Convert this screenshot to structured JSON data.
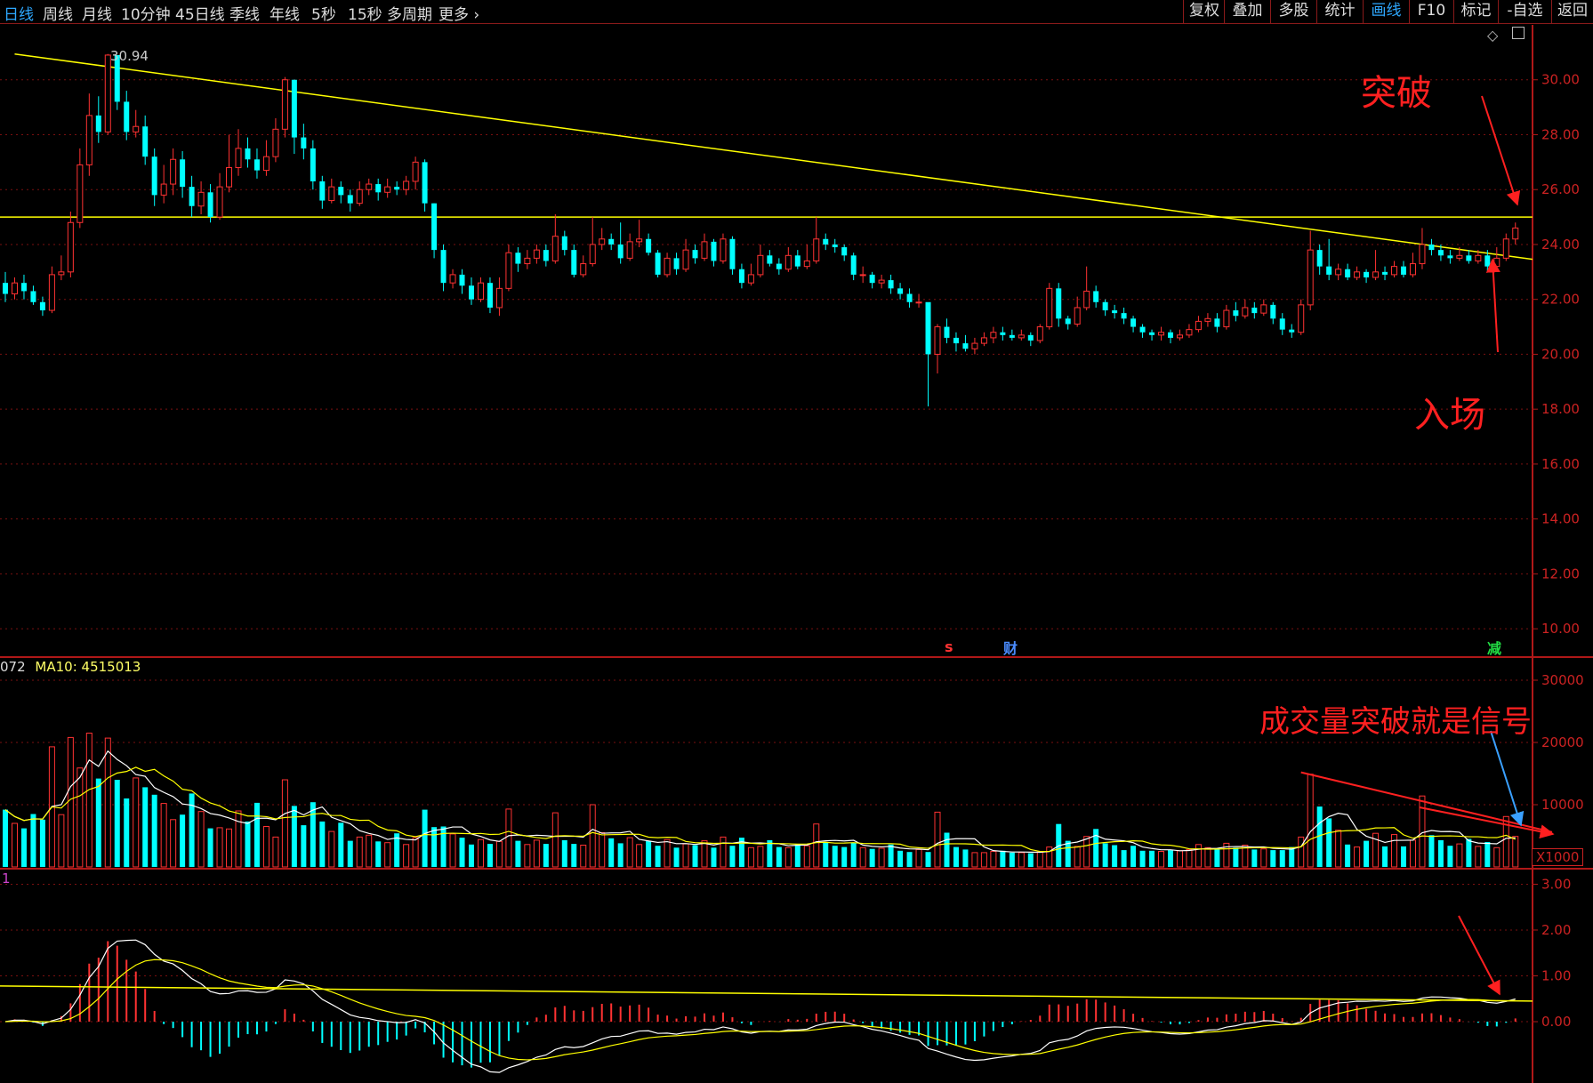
{
  "toolbar": {
    "left_tabs": [
      "日线",
      "周线",
      "月线",
      "10分钟",
      "45日线",
      "季线",
      "年线",
      "5秒",
      "15秒",
      "多周期",
      "更多"
    ],
    "active_left": "日线",
    "right_tabs": [
      "复权",
      "叠加",
      "多股",
      "统计",
      "画线",
      "F10",
      "标记",
      "-自选",
      "返回"
    ],
    "active_right": "画线"
  },
  "price_axis": [
    "30.00",
    "28.00",
    "26.00",
    "24.00",
    "22.00",
    "20.00",
    "18.00",
    "16.00",
    "14.00",
    "12.00",
    "10.00"
  ],
  "high_label": "30.94",
  "markers": {
    "s": "s",
    "cai": "财",
    "jian": "减"
  },
  "volume": {
    "legend_prefix": "072",
    "ma10_label": "MA10: 4515013",
    "axis": [
      "30000",
      "20000",
      "10000"
    ],
    "unit": "X1000"
  },
  "macd": {
    "legend": "1",
    "axis": [
      "3.00",
      "2.00",
      "1.00",
      "0.00"
    ]
  },
  "annotations": {
    "breakout": "突破",
    "entry": "入场",
    "volume_signal": "成交量突破就是信号"
  },
  "colors": {
    "up": "#ff3232",
    "down": "#00ffff",
    "trendline": "#ffff00",
    "grid": "#7a1010",
    "annotation": "#ff2020",
    "blue_arrow": "#3aa0ff"
  },
  "chart_data": {
    "type": "candlestick",
    "y_range": [
      9,
      32
    ],
    "candles": [
      [
        22.6,
        22.2,
        23.0,
        21.9
      ],
      [
        22.2,
        22.6,
        22.8,
        22.0
      ],
      [
        22.6,
        22.3,
        22.9,
        22.0
      ],
      [
        22.3,
        21.9,
        22.5,
        21.8
      ],
      [
        21.9,
        21.6,
        22.1,
        21.4
      ],
      [
        21.6,
        22.9,
        23.2,
        21.5
      ],
      [
        22.9,
        23.0,
        23.6,
        22.7
      ],
      [
        23.0,
        24.8,
        25.2,
        22.8
      ],
      [
        24.8,
        26.9,
        27.5,
        24.6
      ],
      [
        26.9,
        28.7,
        29.5,
        26.5
      ],
      [
        28.7,
        28.1,
        29.4,
        27.7
      ],
      [
        28.1,
        30.9,
        30.94,
        28.0
      ],
      [
        30.9,
        29.2,
        30.5,
        28.9
      ],
      [
        29.2,
        28.1,
        29.6,
        27.8
      ],
      [
        28.1,
        28.3,
        28.9,
        27.9
      ],
      [
        28.3,
        27.2,
        28.7,
        26.9
      ],
      [
        27.2,
        25.8,
        27.5,
        25.4
      ],
      [
        25.8,
        26.2,
        26.9,
        25.5
      ],
      [
        26.2,
        27.1,
        27.5,
        25.8
      ],
      [
        27.1,
        26.1,
        27.4,
        25.7
      ],
      [
        26.1,
        25.4,
        26.5,
        25.0
      ],
      [
        25.4,
        25.9,
        26.3,
        25.1
      ],
      [
        25.9,
        25.0,
        26.2,
        24.8
      ],
      [
        25.0,
        26.1,
        26.6,
        24.9
      ],
      [
        26.1,
        26.8,
        28.0,
        25.9
      ],
      [
        26.8,
        27.5,
        28.2,
        26.5
      ],
      [
        27.5,
        27.1,
        27.9,
        26.8
      ],
      [
        27.1,
        26.7,
        27.5,
        26.4
      ],
      [
        26.7,
        27.2,
        27.8,
        26.5
      ],
      [
        27.2,
        28.2,
        28.6,
        27.0
      ],
      [
        28.2,
        30.0,
        30.1,
        27.9
      ],
      [
        30.0,
        27.9,
        30.0,
        27.3
      ],
      [
        27.9,
        27.5,
        28.4,
        27.1
      ],
      [
        27.5,
        26.3,
        27.8,
        26.0
      ],
      [
        26.3,
        25.6,
        26.5,
        25.3
      ],
      [
        25.6,
        26.1,
        26.4,
        25.5
      ],
      [
        26.1,
        25.8,
        26.3,
        25.5
      ],
      [
        25.8,
        25.5,
        26.0,
        25.2
      ],
      [
        25.5,
        26.0,
        26.3,
        25.4
      ],
      [
        26.0,
        26.2,
        26.4,
        25.8
      ],
      [
        26.2,
        25.9,
        26.4,
        25.6
      ],
      [
        25.9,
        26.1,
        26.4,
        25.7
      ],
      [
        26.1,
        26.0,
        26.3,
        25.8
      ],
      [
        26.0,
        26.3,
        26.5,
        25.8
      ],
      [
        26.3,
        27.0,
        27.2,
        26.0
      ],
      [
        27.0,
        25.5,
        27.1,
        25.2
      ],
      [
        25.5,
        23.8,
        25.5,
        23.5
      ],
      [
        23.8,
        22.6,
        24.0,
        22.3
      ],
      [
        22.6,
        22.9,
        23.1,
        22.4
      ],
      [
        22.9,
        22.5,
        23.1,
        22.2
      ],
      [
        22.5,
        22.0,
        22.8,
        21.8
      ],
      [
        22.0,
        22.6,
        22.8,
        21.9
      ],
      [
        22.6,
        21.7,
        22.8,
        21.5
      ],
      [
        21.7,
        22.4,
        22.8,
        21.4
      ],
      [
        22.4,
        23.7,
        24.0,
        22.3
      ],
      [
        23.7,
        23.3,
        23.9,
        23.0
      ],
      [
        23.3,
        23.5,
        23.8,
        23.1
      ],
      [
        23.5,
        23.8,
        24.0,
        23.3
      ],
      [
        23.8,
        23.4,
        24.0,
        23.2
      ],
      [
        23.4,
        24.3,
        25.1,
        23.3
      ],
      [
        24.3,
        23.8,
        24.5,
        23.6
      ],
      [
        23.8,
        22.9,
        24.0,
        22.8
      ],
      [
        22.9,
        23.3,
        23.6,
        22.8
      ],
      [
        23.3,
        24.0,
        25.0,
        23.2
      ],
      [
        24.0,
        24.2,
        24.6,
        23.8
      ],
      [
        24.2,
        24.0,
        24.4,
        23.8
      ],
      [
        24.0,
        23.5,
        24.8,
        23.3
      ],
      [
        23.5,
        24.1,
        24.4,
        23.4
      ],
      [
        24.1,
        24.2,
        24.9,
        23.9
      ],
      [
        24.2,
        23.7,
        24.4,
        23.6
      ],
      [
        23.7,
        22.9,
        23.8,
        22.8
      ],
      [
        22.9,
        23.5,
        23.7,
        22.8
      ],
      [
        23.5,
        23.1,
        23.7,
        22.9
      ],
      [
        23.1,
        23.8,
        24.2,
        23.0
      ],
      [
        23.8,
        23.5,
        24.0,
        23.3
      ],
      [
        23.5,
        24.1,
        24.4,
        23.4
      ],
      [
        24.1,
        23.4,
        24.2,
        23.2
      ],
      [
        23.4,
        24.2,
        24.4,
        23.3
      ],
      [
        24.2,
        23.1,
        24.3,
        22.9
      ],
      [
        23.1,
        22.6,
        23.3,
        22.4
      ],
      [
        22.6,
        22.9,
        23.3,
        22.5
      ],
      [
        22.9,
        23.6,
        24.0,
        22.8
      ],
      [
        23.6,
        23.3,
        23.8,
        23.2
      ],
      [
        23.3,
        23.1,
        23.5,
        22.9
      ],
      [
        23.1,
        23.6,
        23.9,
        23.0
      ],
      [
        23.6,
        23.2,
        23.8,
        23.1
      ],
      [
        23.2,
        23.4,
        24.0,
        23.1
      ],
      [
        23.4,
        24.2,
        25.0,
        23.3
      ],
      [
        24.2,
        24.0,
        24.4,
        23.8
      ],
      [
        24.0,
        23.9,
        24.2,
        23.7
      ],
      [
        23.9,
        23.6,
        24.0,
        23.4
      ],
      [
        23.6,
        22.9,
        23.7,
        22.7
      ],
      [
        22.9,
        22.9,
        23.2,
        22.6
      ],
      [
        22.9,
        22.6,
        23.0,
        22.4
      ],
      [
        22.6,
        22.7,
        22.9,
        22.4
      ],
      [
        22.7,
        22.4,
        22.9,
        22.2
      ],
      [
        22.4,
        22.2,
        22.6,
        22.0
      ],
      [
        22.2,
        21.9,
        22.4,
        21.7
      ],
      [
        21.9,
        21.9,
        22.2,
        21.7
      ],
      [
        21.9,
        20.0,
        21.2,
        18.1
      ],
      [
        20.0,
        21.0,
        21.1,
        19.3
      ],
      [
        21.0,
        20.6,
        21.3,
        20.4
      ],
      [
        20.6,
        20.4,
        20.8,
        20.1
      ],
      [
        20.4,
        20.2,
        20.7,
        20.1
      ],
      [
        20.2,
        20.4,
        20.6,
        20.0
      ],
      [
        20.4,
        20.6,
        20.8,
        20.3
      ],
      [
        20.6,
        20.8,
        21.0,
        20.4
      ],
      [
        20.8,
        20.7,
        21.0,
        20.5
      ],
      [
        20.7,
        20.6,
        20.9,
        20.5
      ],
      [
        20.6,
        20.7,
        20.9,
        20.5
      ],
      [
        20.7,
        20.5,
        20.8,
        20.3
      ],
      [
        20.5,
        21.0,
        21.1,
        20.4
      ],
      [
        21.0,
        22.4,
        22.6,
        20.9
      ],
      [
        22.4,
        21.3,
        22.6,
        21.0
      ],
      [
        21.3,
        21.1,
        21.4,
        20.9
      ],
      [
        21.1,
        21.7,
        22.1,
        21.0
      ],
      [
        21.7,
        22.3,
        23.2,
        21.6
      ],
      [
        22.3,
        21.9,
        22.5,
        21.7
      ],
      [
        21.9,
        21.6,
        22.0,
        21.4
      ],
      [
        21.6,
        21.5,
        21.8,
        21.3
      ],
      [
        21.5,
        21.3,
        21.7,
        21.1
      ],
      [
        21.3,
        21.0,
        21.4,
        20.8
      ],
      [
        21.0,
        20.8,
        21.1,
        20.6
      ],
      [
        20.8,
        20.7,
        20.9,
        20.5
      ],
      [
        20.7,
        20.8,
        21.0,
        20.5
      ],
      [
        20.8,
        20.6,
        20.9,
        20.4
      ],
      [
        20.6,
        20.7,
        20.9,
        20.5
      ],
      [
        20.7,
        20.9,
        21.1,
        20.6
      ],
      [
        20.9,
        21.2,
        21.4,
        20.8
      ],
      [
        21.2,
        21.3,
        21.5,
        21.0
      ],
      [
        21.3,
        21.0,
        21.5,
        20.8
      ],
      [
        21.0,
        21.6,
        21.8,
        20.9
      ],
      [
        21.6,
        21.4,
        21.9,
        21.2
      ],
      [
        21.4,
        21.7,
        22.0,
        21.3
      ],
      [
        21.7,
        21.5,
        21.9,
        21.3
      ],
      [
        21.5,
        21.8,
        22.0,
        21.4
      ],
      [
        21.8,
        21.3,
        21.9,
        21.1
      ],
      [
        21.3,
        20.9,
        21.5,
        20.7
      ],
      [
        20.9,
        20.8,
        21.1,
        20.6
      ],
      [
        20.8,
        21.8,
        22.0,
        20.7
      ],
      [
        21.8,
        23.8,
        24.5,
        21.6
      ],
      [
        23.8,
        23.2,
        24.0,
        22.9
      ],
      [
        23.2,
        22.9,
        24.2,
        22.7
      ],
      [
        22.9,
        23.1,
        23.3,
        22.7
      ],
      [
        23.1,
        22.8,
        23.3,
        22.7
      ],
      [
        22.8,
        23.0,
        23.2,
        22.7
      ],
      [
        23.0,
        22.8,
        23.1,
        22.6
      ],
      [
        22.8,
        23.0,
        23.8,
        22.7
      ],
      [
        23.0,
        22.9,
        23.2,
        22.7
      ],
      [
        22.9,
        23.2,
        23.4,
        22.8
      ],
      [
        23.2,
        22.9,
        23.4,
        22.8
      ],
      [
        22.9,
        23.3,
        23.7,
        22.8
      ],
      [
        23.3,
        24.0,
        24.6,
        23.1
      ],
      [
        24.0,
        23.8,
        24.2,
        23.6
      ],
      [
        23.8,
        23.6,
        24.0,
        23.4
      ],
      [
        23.6,
        23.5,
        23.8,
        23.3
      ],
      [
        23.5,
        23.6,
        23.9,
        23.4
      ],
      [
        23.6,
        23.4,
        23.8,
        23.3
      ],
      [
        23.4,
        23.6,
        23.8,
        23.3
      ],
      [
        23.6,
        23.2,
        23.8,
        23.0
      ],
      [
        23.2,
        23.5,
        23.9,
        23.1
      ],
      [
        23.5,
        24.2,
        24.4,
        23.4
      ],
      [
        24.2,
        24.6,
        24.8,
        24.0
      ]
    ],
    "volume_k": [
      9200,
      7000,
      6200,
      8500,
      7600,
      19300,
      8400,
      20800,
      15900,
      21500,
      14200,
      20700,
      14000,
      11000,
      14300,
      12800,
      11600,
      10200,
      7600,
      8400,
      11800,
      8900,
      6200,
      6300,
      6100,
      9000,
      7300,
      10300,
      6500,
      4800,
      14000,
      9800,
      6700,
      10400,
      7300,
      5700,
      7100,
      4200,
      4800,
      5100,
      4100,
      3900,
      5400,
      3600,
      4700,
      9200,
      6400,
      6500,
      5300,
      4700,
      3600,
      4400,
      3700,
      4100,
      9300,
      4200,
      3600,
      4300,
      3700,
      8700,
      4300,
      3700,
      3500,
      10000,
      5500,
      4600,
      3800,
      4700,
      3600,
      4200,
      3400,
      4400,
      3100,
      3700,
      3500,
      4200,
      3100,
      4800,
      3400,
      4700,
      3100,
      3300,
      4300,
      3200,
      3100,
      3600,
      3400,
      6900,
      4000,
      3400,
      3200,
      3900,
      3100,
      2900,
      3000,
      3600,
      2600,
      2400,
      2800,
      2400,
      8800,
      5500,
      3200,
      2800,
      2300,
      2300,
      2500,
      2600,
      2300,
      2300,
      2200,
      2400,
      3200,
      6900,
      4200,
      3300,
      4900,
      6100,
      3800,
      3500,
      2700,
      3400,
      2600,
      2600,
      2500,
      2700,
      2600,
      2800,
      3600,
      3100,
      2800,
      3800,
      3100,
      3500,
      2800,
      2900,
      2700,
      2700,
      3200,
      4800,
      14900,
      9700,
      7800,
      5900,
      3600,
      3200,
      4200,
      5400,
      3300,
      5200,
      3300,
      4300,
      11400,
      5100,
      4300,
      3400,
      3700,
      4500,
      3300,
      4000,
      3100,
      8100,
      4900
    ],
    "trendline_from": [
      1,
      30.94
    ],
    "trendline_to": [
      163,
      23.5
    ],
    "horizontal_line": 25.0
  }
}
